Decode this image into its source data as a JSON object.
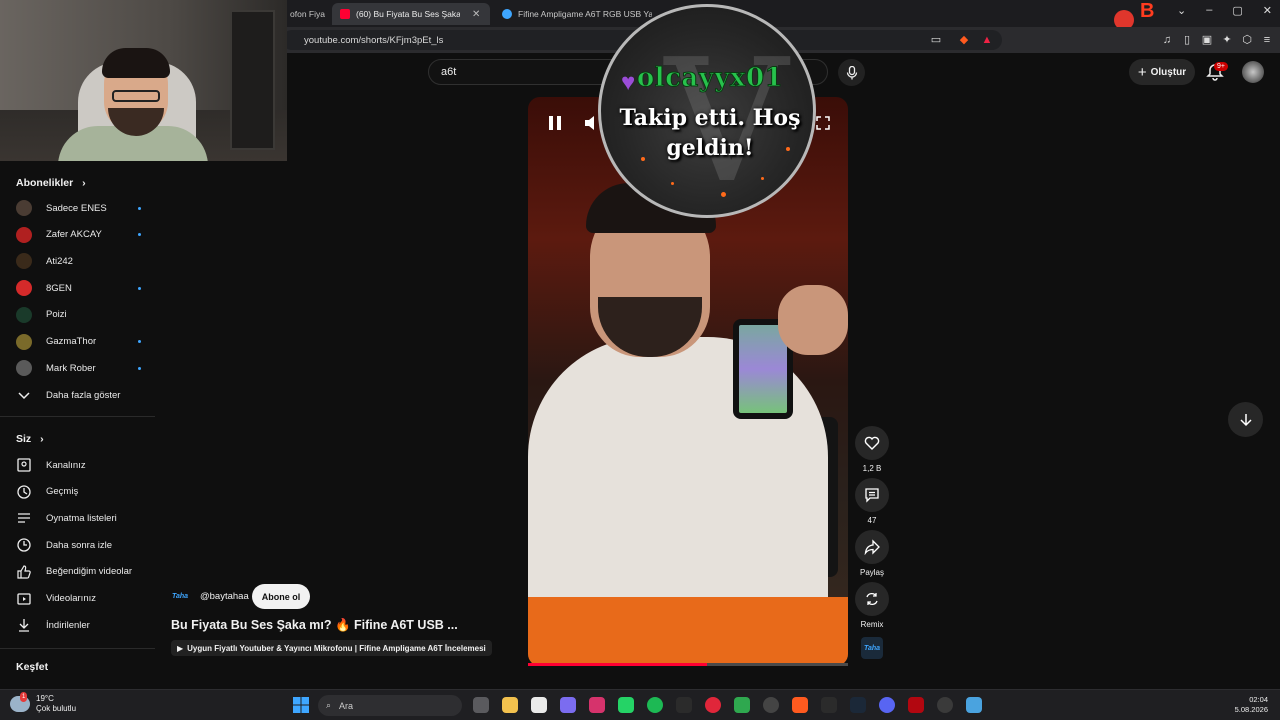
{
  "browser": {
    "tabs": [
      {
        "label": "ofon Fiya"
      },
      {
        "label": "(60) Bu Fiyata Bu Ses Şaka mı"
      },
      {
        "label": "Fifine Ampligame A6T RGB USB Yay"
      }
    ],
    "url": "youtube.com/shorts/KFjm3pEt_ls"
  },
  "header": {
    "search_value": "a6t",
    "create_label": "Oluştur",
    "notification_count": "9+"
  },
  "sidebar": {
    "subscriptions_title": "Abonelikler",
    "subscriptions": [
      {
        "label": "Sadece ENES",
        "color": "#4a3c33"
      },
      {
        "label": "Zafer AKCAY",
        "color": "#b02020"
      },
      {
        "label": "Ati242",
        "color": "#3a2a1a"
      },
      {
        "label": "8GEN",
        "color": "#d42a2a"
      },
      {
        "label": "Poizi",
        "color": "#1a3a2a"
      },
      {
        "label": "GazmaThor",
        "color": "#7a6a2a"
      },
      {
        "label": "Mark Rober",
        "color": "#5a5a5a"
      }
    ],
    "show_more": "Daha fazla göster",
    "you_title": "Siz",
    "you_items": [
      {
        "label": "Kanalınız",
        "icon": "channel-icon"
      },
      {
        "label": "Geçmiş",
        "icon": "history-icon"
      },
      {
        "label": "Oynatma listeleri",
        "icon": "playlist-icon"
      },
      {
        "label": "Daha sonra izle",
        "icon": "watch-later-icon"
      },
      {
        "label": "Beğendiğim videolar",
        "icon": "like-icon"
      },
      {
        "label": "Videolarınız",
        "icon": "your-videos-icon"
      },
      {
        "label": "İndirilenler",
        "icon": "download-icon"
      }
    ],
    "explore_title": "Keşfet"
  },
  "alert": {
    "username": "olcayyx01",
    "message": "Takip etti. Hoş geldin!"
  },
  "short": {
    "progress": 0.56,
    "likes": "1,2 B",
    "comments": "47",
    "share_label": "Paylaş",
    "remix_label": "Remix",
    "channel_logo_text": "Taha",
    "channel_handle": "@baytahaa",
    "subscribe_label": "Abone ol",
    "title": "Bu Fiyata Bu Ses Şaka mı? 🔥 Fifine A6T USB ...",
    "related_video": "Uygun Fiyatlı Youtuber & Yayıncı Mikrofonu | Fifine Ampligame A6T İncelemesi"
  },
  "taskbar": {
    "temperature": "19°C",
    "weather": "Çok bulutlu",
    "weather_badge": "1",
    "search_placeholder": "Ara",
    "time": "02:04",
    "date": "5.08.2026"
  }
}
